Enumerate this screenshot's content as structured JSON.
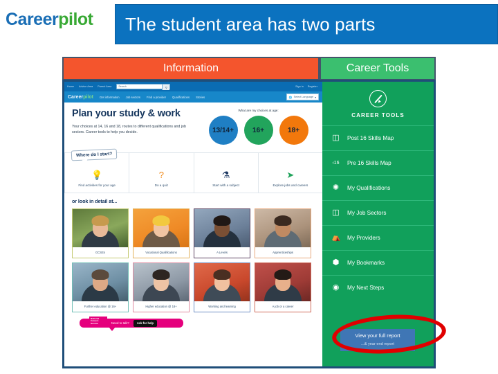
{
  "slide": {
    "logo": {
      "part1": "Career",
      "part2": "pilot",
      "color1": "#1a6eb5",
      "color2": "#39a935"
    },
    "title": "The student area has two parts",
    "title_bg": "#0b72bf"
  },
  "tabs": [
    {
      "label": "Information",
      "color": "#f4552d"
    },
    {
      "label": "Career Tools",
      "color": "#3bbf6f"
    }
  ],
  "screenshot": {
    "browser_nav_top": {
      "links": [
        "Home",
        "Advice Area",
        "Parent Area"
      ],
      "search_placeholder": "Search",
      "search_icon": "search-icon",
      "right_links": [
        "Sign in",
        "Register"
      ]
    },
    "browser_nav_main": {
      "logo_part1": "Career",
      "logo_part2": "pilot",
      "items": [
        "Get information",
        "Job sectors",
        "Find a provider",
        "Qualifications",
        "Stories"
      ],
      "translate": "Select Language"
    },
    "hero": {
      "heading": "Plan your study & work",
      "body": "Your choices at 14, 16 and 18, routes to different qualifications and job sectors. Career tools to help you decide.",
      "question": "What are my choices at age:",
      "circles": [
        {
          "label": "13/14+",
          "color": "#1f7fc4"
        },
        {
          "label": "16+",
          "color": "#22a45c"
        },
        {
          "label": "18+",
          "color": "#f2780c"
        }
      ]
    },
    "start": {
      "bubble": "Where do I start?",
      "tiles": [
        {
          "label": "Find activities for your age",
          "icon": "lightbulb-icon",
          "glyph": "●",
          "color": "#d6268c"
        },
        {
          "label": "Do a quiz",
          "icon": "question-mark-icon",
          "glyph": "?",
          "color": "#f08a1c"
        },
        {
          "label": "Start with a subject",
          "icon": "flask-icon",
          "glyph": "⚗",
          "color": "#1f3a63"
        },
        {
          "label": "Explore jobs and careers",
          "icon": "paper-plane-icon",
          "glyph": "➤",
          "color": "#22a45c"
        }
      ]
    },
    "detail": {
      "heading": "or look in detail at...",
      "cards_row1": [
        {
          "label": "GCSEs"
        },
        {
          "label": "Vocational Qualifications"
        },
        {
          "label": "A Levels"
        },
        {
          "label": "Apprenticeships"
        }
      ],
      "cards_row2": [
        {
          "label": "Further education @ 16+"
        },
        {
          "label": "Higher education @ 18+"
        },
        {
          "label": "Working and learning"
        },
        {
          "label": "A job or a career"
        }
      ]
    },
    "national_careers": {
      "logo_line1": "National",
      "logo_line2": "Careers",
      "logo_line3": "Service",
      "prompt": "Need to talk?",
      "button": "Ask for help",
      "color": "#e5007d"
    },
    "career_tools": {
      "title": "CAREER TOOLS",
      "header_icon": "pencil-circle-icon",
      "panel_color": "#11a05b",
      "items": [
        {
          "label": "Post 16 Skills Map",
          "icon": "map-icon",
          "glyph": "◫"
        },
        {
          "label": "Pre 16 Skills Map",
          "icon": "less-than-16-icon",
          "glyph": "¹16"
        },
        {
          "label": "My Qualifications",
          "icon": "cog-icon",
          "glyph": "⚙"
        },
        {
          "label": "My Job Sectors",
          "icon": "briefcase-icon",
          "glyph": "Ὃc"
        },
        {
          "label": "My Providers",
          "icon": "bank-icon",
          "glyph": "Ἵb"
        },
        {
          "label": "My Bookmarks",
          "icon": "bookmark-icon",
          "glyph": "ὑ6"
        },
        {
          "label": "My Next Steps",
          "icon": "compass-icon",
          "glyph": "⊙"
        }
      ],
      "report": {
        "title": "View your full report",
        "subtitle": "...& year end report",
        "button_color": "#3f76b5"
      }
    },
    "annotation": {
      "shape": "red-ellipse-highlight",
      "color": "#e00000"
    }
  }
}
